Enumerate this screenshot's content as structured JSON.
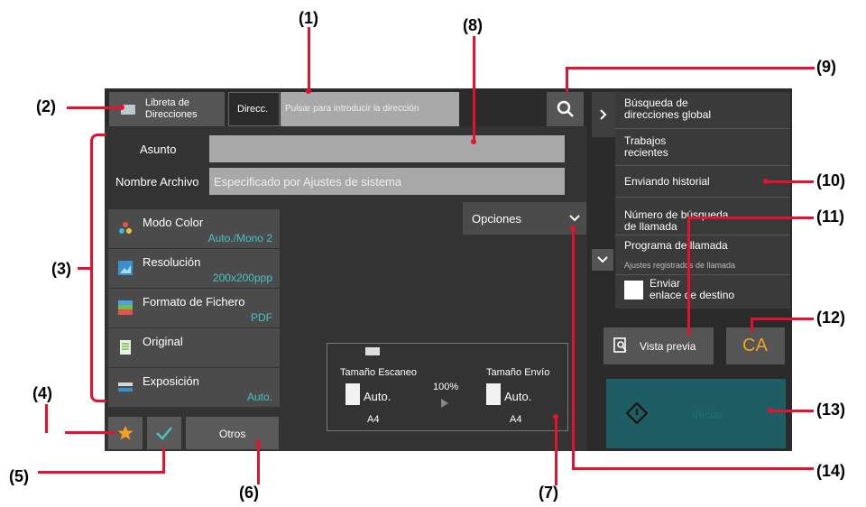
{
  "callouts": [
    "(1)",
    "(2)",
    "(3)",
    "(4)",
    "(5)",
    "(6)",
    "(7)",
    "(8)",
    "(9)",
    "(10)",
    "(11)",
    "(12)",
    "(13)",
    "(14)"
  ],
  "header": {
    "address_book": [
      "Libreta de",
      "Direcciones"
    ],
    "direcc_tab": "Direcc.",
    "address_placeholder": "Pulsar para introducir la dirección"
  },
  "fields": {
    "subject_label": "Asunto",
    "subject_value": "",
    "filename_label": "Nombre Archivo",
    "filename_placeholder": "Especificado por Ajustes de sistema"
  },
  "options_label": "Opciones",
  "settings": [
    {
      "title": "Modo Color",
      "value": "Auto./Mono 2"
    },
    {
      "title": "Resolución",
      "value": "200x200ppp"
    },
    {
      "title": "Formato de Fichero",
      "value": "PDF"
    },
    {
      "title": "Original",
      "value": ""
    },
    {
      "title": "Exposición",
      "value": "Auto."
    }
  ],
  "bottom": {
    "otros": "Otros"
  },
  "preview_box": {
    "scan_size_label": "Tamaño Escaneo",
    "send_size_label": "Tamaño Envío",
    "scan_auto": "Auto.",
    "send_auto": "Auto.",
    "ratio": "100%",
    "scan_paper": "A4",
    "send_paper": "A4"
  },
  "right_panel": {
    "items": [
      [
        "Búsqueda de",
        "direcciones global"
      ],
      [
        "Trabajos",
        "recientes"
      ],
      [
        "Enviando historial"
      ],
      [
        "Número de búsqueda",
        "de llamada"
      ],
      [
        "Programa de llamada"
      ]
    ],
    "program_sub": "Ajustes registrados de llamada",
    "send_link": [
      "Enviar",
      "enlace de destino"
    ]
  },
  "preview_button": "Vista previa",
  "ca_button": "CA",
  "start_button": "Iniciar",
  "colors": {
    "callout_line": "#e2132e",
    "accent": "#47c2c6",
    "start_bg": "#1e5d63"
  }
}
